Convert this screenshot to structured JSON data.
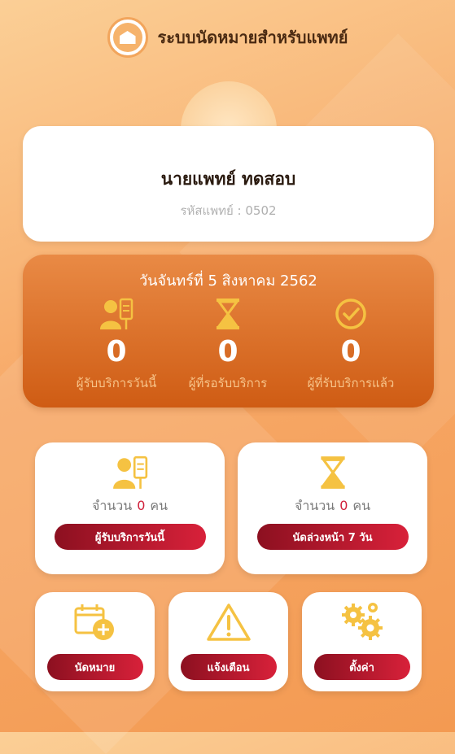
{
  "header": {
    "title": "ระบบนัดหมายสำหรับแพทย์"
  },
  "profile": {
    "name": "นายแพทย์ ทดสอบ",
    "code": "รหัสแพทย์ : 0502"
  },
  "summary": {
    "date": "วันจันทร์ที่ 5 สิงหาคม 2562",
    "stats": [
      {
        "value": "0",
        "label": "ผู้รับบริการวันนี้",
        "icon": "patient-icon"
      },
      {
        "value": "0",
        "label": "ผู้ที่รอรับบริการ",
        "icon": "hourglass-icon"
      },
      {
        "value": "0",
        "label": "ผู้ที่รับบริการแล้ว",
        "icon": "check-circle-icon"
      }
    ]
  },
  "cards": {
    "today": {
      "prefix": "จำนวน",
      "count": "0",
      "unit": "คน",
      "button": "ผู้รับบริการวันนี้"
    },
    "advance": {
      "prefix": "จำนวน",
      "count": "0",
      "unit": "คน",
      "button": "นัดล่วงหน้า 7 วัน"
    }
  },
  "menu": {
    "appointment": "นัดหมาย",
    "notify": "แจ้งเตือน",
    "settings": "ตั้งค่า"
  },
  "colors": {
    "accent": "#f5a623",
    "button": "#c21a30",
    "panel": "#d9681f"
  }
}
